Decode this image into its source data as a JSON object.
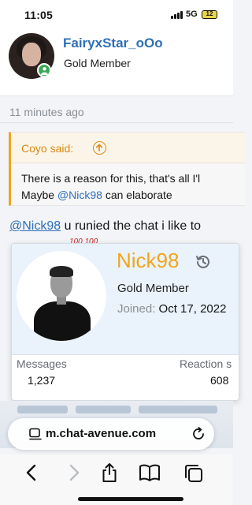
{
  "status_bar": {
    "time": "11:05",
    "network": "5G",
    "battery": "12"
  },
  "post": {
    "username": "FairyxStar_oOo",
    "rank": "Gold Member",
    "time_ago": "11 minutes ago",
    "quote": {
      "author": "Coyo said:",
      "line1": "There is a reason for this, that's all I'l",
      "line2_pre": "Maybe ",
      "line2_mention": "@Nick98",
      "line2_post": " can elaborate"
    },
    "reply_mention": "@Nick98",
    "reply_text": " u runied the chat i like to",
    "reactions": "100 100"
  },
  "member_card": {
    "name": "Nick98",
    "rank": "Gold Member",
    "joined_label": "Joined:",
    "joined_value": "Oct 17, 2022",
    "stats": {
      "messages_label": "Messages",
      "messages_value": "1,237",
      "reactions_label": "Reaction s",
      "reactions_value": "608"
    }
  },
  "browser": {
    "url": "m.chat-avenue.com"
  },
  "colors": {
    "accent": "#f0a51c",
    "link": "#2f6fb7",
    "online": "#3ea85a"
  }
}
